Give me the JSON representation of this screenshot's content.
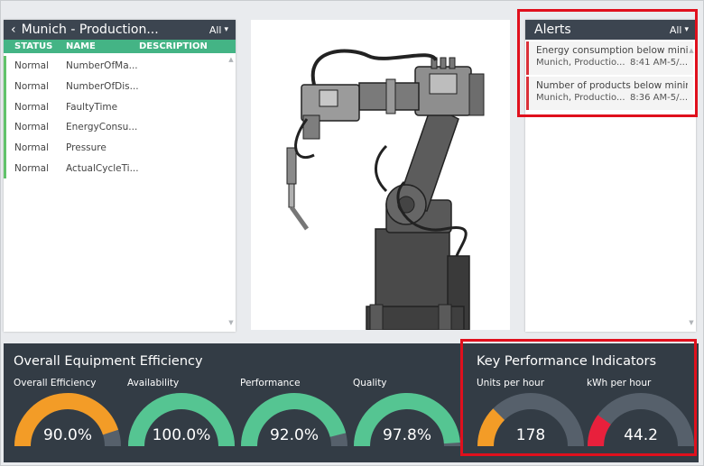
{
  "sensor_panel": {
    "title": "Munich - Production...",
    "filter_label": "All",
    "columns": {
      "status": "STATUS",
      "name": "NAME",
      "description": "DESCRIPTION"
    },
    "rows": [
      {
        "status": "Normal",
        "name": "NumberOfMa...",
        "description": ""
      },
      {
        "status": "Normal",
        "name": "NumberOfDis...",
        "description": ""
      },
      {
        "status": "Normal",
        "name": "FaultyTime",
        "description": ""
      },
      {
        "status": "Normal",
        "name": "EnergyConsu...",
        "description": ""
      },
      {
        "status": "Normal",
        "name": "Pressure",
        "description": ""
      },
      {
        "status": "Normal",
        "name": "ActualCycleTi...",
        "description": ""
      }
    ]
  },
  "alerts_panel": {
    "title": "Alerts",
    "filter_label": "All",
    "items": [
      {
        "message": "Energy consumption below minim",
        "source": "Munich, Productio...",
        "time": "8:41 AM-5/..."
      },
      {
        "message": "Number of products below minim",
        "source": "Munich, Productio...",
        "time": "8:36 AM-5/..."
      }
    ]
  },
  "oee": {
    "title": "Overall Equipment Efficiency",
    "gauges": [
      {
        "label": "Overall Efficiency",
        "value_text": "90.0%",
        "fraction": 0.9,
        "color": "#f39c27"
      },
      {
        "label": "Availability",
        "value_text": "100.0%",
        "fraction": 1.0,
        "color": "#55c592"
      },
      {
        "label": "Performance",
        "value_text": "92.0%",
        "fraction": 0.92,
        "color": "#55c592"
      },
      {
        "label": "Quality",
        "value_text": "97.8%",
        "fraction": 0.978,
        "color": "#55c592"
      }
    ]
  },
  "kpi": {
    "title": "Key Performance Indicators",
    "gauges": [
      {
        "label": "Units per hour",
        "value_text": "178",
        "fraction": 0.25,
        "color": "#f39c27"
      },
      {
        "label": "kWh per hour",
        "value_text": "44.2",
        "fraction": 0.2,
        "color": "#e8203c"
      }
    ]
  },
  "colors": {
    "header_bg": "#3c4550",
    "columns_bg": "#44b485",
    "status_normal": "#61c26a",
    "alert_accent": "#d9313a",
    "dashboard_bg": "#333c45",
    "gauge_track": "#56606b",
    "highlight": "#e0101d"
  }
}
